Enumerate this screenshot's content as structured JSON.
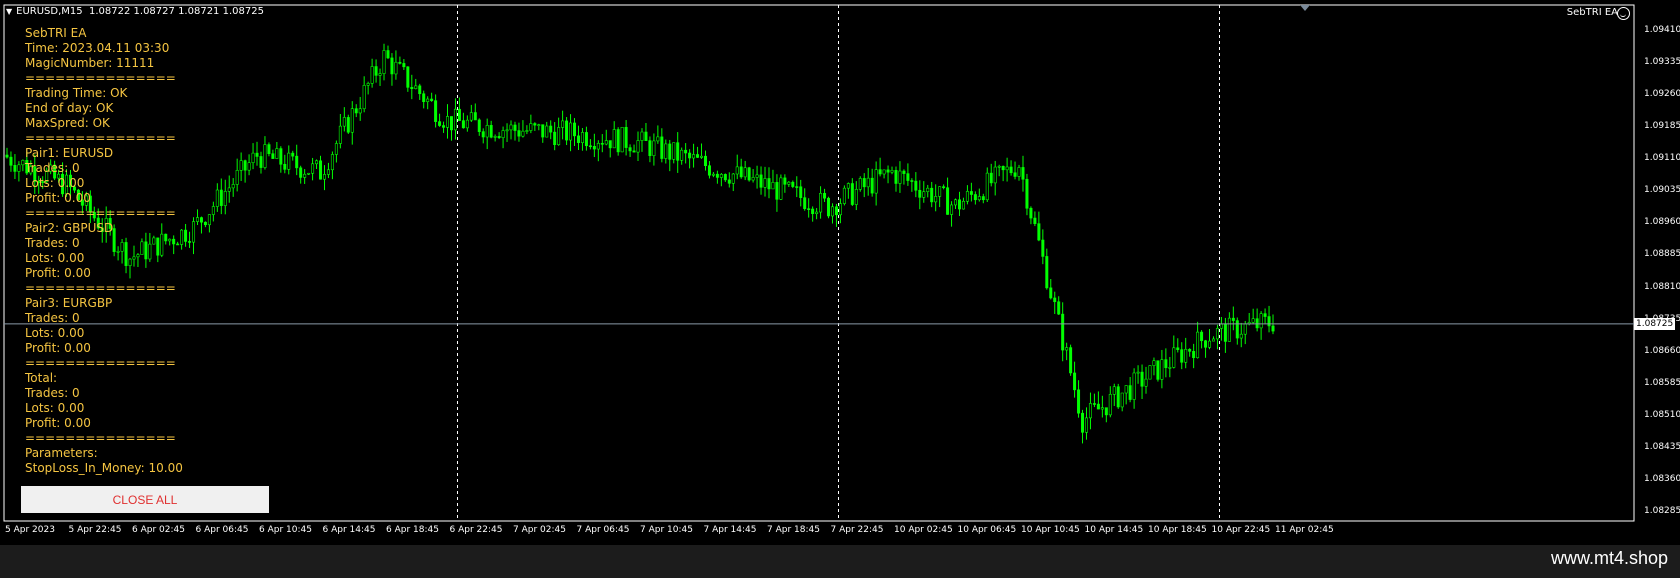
{
  "header": {
    "symbol": "EURUSD,M15",
    "quote": "1.08722 1.08727 1.08721 1.08725"
  },
  "ea_label": "SebTRI EA",
  "info_lines": [
    "SebTRI EA",
    "Time: 2023.04.11 03:30",
    "MagicNumber: 11111",
    "===============",
    "Trading Time: OK",
    "End of day: OK",
    "MaxSpred: OK",
    "===============",
    "Pair1: EURUSD",
    "Trades: 0",
    "Lots: 0.00",
    "Profit: 0.00",
    "===============",
    "Pair2: GBPUSD",
    "Trades: 0",
    "Lots: 0.00",
    "Profit: 0.00",
    "===============",
    "Pair3: EURGBP",
    "Trades: 0",
    "Lots: 0.00",
    "Profit: 0.00",
    "===============",
    "Total:",
    "Trades: 0",
    "Lots: 0.00",
    "Profit: 0.00",
    "===============",
    "Parameters:",
    "StopLoss_In_Money: 10.00"
  ],
  "close_all_label": "CLOSE ALL",
  "price_axis": [
    "1.09410",
    "1.09335",
    "1.09260",
    "1.09185",
    "1.09110",
    "1.09035",
    "1.08960",
    "1.08885",
    "1.08810",
    "1.08735",
    "1.08660",
    "1.08585",
    "1.08510",
    "1.08435",
    "1.08360",
    "1.08285"
  ],
  "current_price": "1.08725",
  "time_axis": [
    "5 Apr 2023",
    "5 Apr 22:45",
    "6 Apr 02:45",
    "6 Apr 06:45",
    "6 Apr 10:45",
    "6 Apr 14:45",
    "6 Apr 18:45",
    "6 Apr 22:45",
    "7 Apr 02:45",
    "7 Apr 06:45",
    "7 Apr 10:45",
    "7 Apr 14:45",
    "7 Apr 18:45",
    "7 Apr 22:45",
    "10 Apr 02:45",
    "10 Apr 06:45",
    "10 Apr 10:45",
    "10 Apr 14:45",
    "10 Apr 18:45",
    "10 Apr 22:45",
    "11 Apr 02:45"
  ],
  "watermark": "www.mt4.shop",
  "colors": {
    "candles": "#00ff00",
    "info_text": "#f5c542",
    "close_button_text": "#e03030",
    "background": "#000000"
  },
  "chart_data": {
    "type": "line",
    "symbol": "EURUSD",
    "timeframe": "M15",
    "ylim": [
      1.0828,
      1.0945
    ],
    "x": [
      "5 Apr 2023",
      "5 Apr 22:45",
      "6 Apr 02:45",
      "6 Apr 06:45",
      "6 Apr 10:45",
      "6 Apr 14:45",
      "6 Apr 18:45",
      "6 Apr 22:45",
      "7 Apr 02:45",
      "7 Apr 06:45",
      "7 Apr 10:45",
      "7 Apr 14:45",
      "7 Apr 18:45",
      "7 Apr 22:45",
      "10 Apr 02:45",
      "10 Apr 06:45",
      "10 Apr 10:45",
      "10 Apr 14:45",
      "10 Apr 18:45",
      "10 Apr 22:45",
      "11 Apr 02:45"
    ],
    "series": [
      {
        "values": [
          1.0912,
          1.0905,
          1.0888,
          1.0895,
          1.0912,
          1.0908,
          1.0935,
          1.092,
          1.0918,
          1.0917,
          1.0915,
          1.091,
          1.0905,
          1.09,
          1.0908,
          1.09,
          1.091,
          1.085,
          1.086,
          1.087,
          1.0873
        ]
      }
    ],
    "current_price": 1.08725
  }
}
